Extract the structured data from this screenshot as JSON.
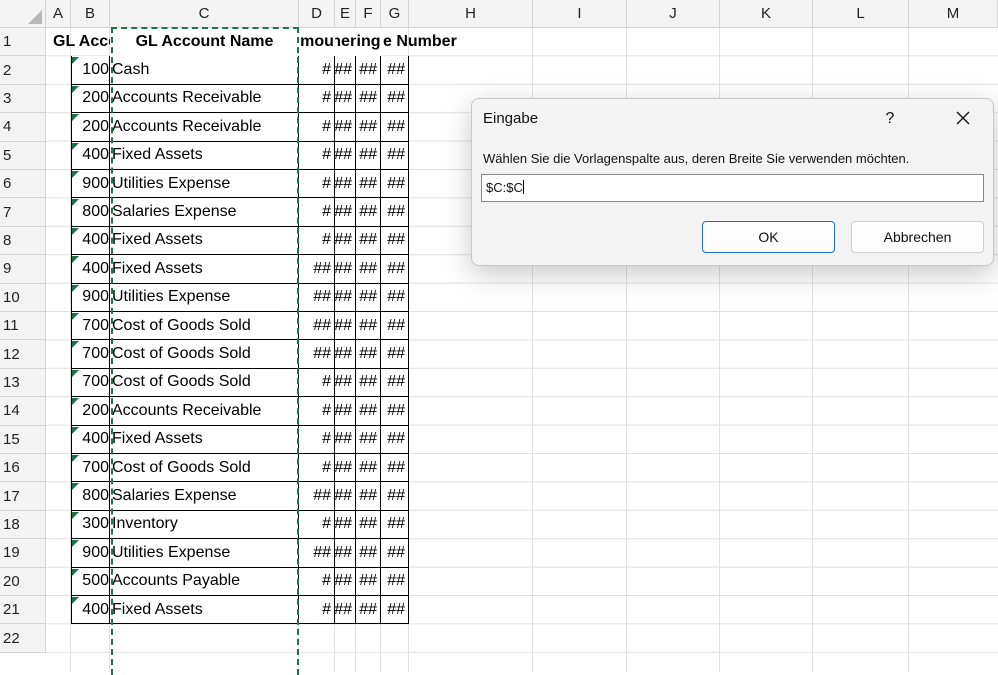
{
  "columns": [
    "A",
    "B",
    "C",
    "D",
    "E",
    "F",
    "G",
    "H",
    "I",
    "J",
    "K",
    "L",
    "M"
  ],
  "rows": [
    "1",
    "2",
    "3",
    "4",
    "5",
    "6",
    "7",
    "8",
    "9",
    "10",
    "11",
    "12",
    "13",
    "14",
    "15",
    "16",
    "17",
    "18",
    "19",
    "20",
    "21",
    "22"
  ],
  "header_row": {
    "b": "GL Acco",
    "c": "GL Account Name",
    "d": "mou",
    "e": "nen",
    "f": "ing",
    "g": "e Number"
  },
  "data_rows": [
    {
      "b": "100",
      "c": "Cash",
      "d": "#",
      "e": "##",
      "f": "##",
      "g": "##"
    },
    {
      "b": "200",
      "c": "Accounts Receivable",
      "d": "#",
      "e": "##",
      "f": "##",
      "g": "##"
    },
    {
      "b": "200",
      "c": "Accounts Receivable",
      "d": "#",
      "e": "##",
      "f": "##",
      "g": "##"
    },
    {
      "b": "400",
      "c": "Fixed Assets",
      "d": "#",
      "e": "##",
      "f": "##",
      "g": "##"
    },
    {
      "b": "900",
      "c": "Utilities Expense",
      "d": "#",
      "e": "##",
      "f": "##",
      "g": "##"
    },
    {
      "b": "800",
      "c": "Salaries Expense",
      "d": "#",
      "e": "##",
      "f": "##",
      "g": "##"
    },
    {
      "b": "400",
      "c": "Fixed Assets",
      "d": "#",
      "e": "##",
      "f": "##",
      "g": "##"
    },
    {
      "b": "400",
      "c": "Fixed Assets",
      "d": "##",
      "e": "##",
      "f": "##",
      "g": "##"
    },
    {
      "b": "900",
      "c": "Utilities Expense",
      "d": "##",
      "e": "##",
      "f": "##",
      "g": "##"
    },
    {
      "b": "700",
      "c": "Cost of Goods Sold",
      "d": "##",
      "e": "##",
      "f": "##",
      "g": "##"
    },
    {
      "b": "700",
      "c": "Cost of Goods Sold",
      "d": "##",
      "e": "##",
      "f": "##",
      "g": "##"
    },
    {
      "b": "700",
      "c": "Cost of Goods Sold",
      "d": "#",
      "e": "##",
      "f": "##",
      "g": "##"
    },
    {
      "b": "200",
      "c": "Accounts Receivable",
      "d": "#",
      "e": "##",
      "f": "##",
      "g": "##"
    },
    {
      "b": "400",
      "c": "Fixed Assets",
      "d": "#",
      "e": "##",
      "f": "##",
      "g": "##"
    },
    {
      "b": "700",
      "c": "Cost of Goods Sold",
      "d": "#",
      "e": "##",
      "f": "##",
      "g": "##"
    },
    {
      "b": "800",
      "c": "Salaries Expense",
      "d": "##",
      "e": "##",
      "f": "##",
      "g": "##"
    },
    {
      "b": "300",
      "c": "Inventory",
      "d": "#",
      "e": "##",
      "f": "##",
      "g": "##"
    },
    {
      "b": "900",
      "c": "Utilities Expense",
      "d": "##",
      "e": "##",
      "f": "##",
      "g": "##"
    },
    {
      "b": "500",
      "c": "Accounts Payable",
      "d": "#",
      "e": "##",
      "f": "##",
      "g": "##"
    },
    {
      "b": "400",
      "c": "Fixed Assets",
      "d": "#",
      "e": "##",
      "f": "##",
      "g": "##"
    }
  ],
  "dialog": {
    "title": "Eingabe",
    "help_label": "?",
    "close_icon": "close-icon",
    "prompt": "Wählen Sie die Vorlagenspalte aus, deren Breite Sie verwenden möchten.",
    "input_value": "$C:$C",
    "ok_label": "OK",
    "cancel_label": "Abbrechen"
  },
  "colors": {
    "selection_marquee": "#217346",
    "error_indicator": "#1e7145",
    "ok_border": "#1b6ecb"
  }
}
